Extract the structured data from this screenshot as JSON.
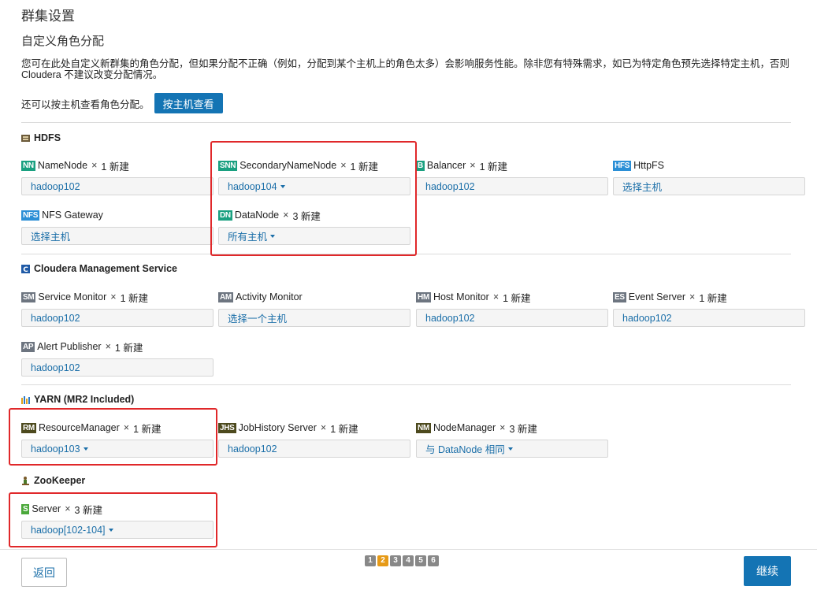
{
  "page_title": "群集设置",
  "sub_title": "自定义角色分配",
  "description": "您可在此处自定义新群集的角色分配，但如果分配不正确（例如，分配到某个主机上的角色太多）会影响服务性能。除非您有特殊需求，如已为特定角色预先选择特定主机，否则 Cloudera 不建议改变分配情况。",
  "host_view_text": "还可以按主机查看角色分配。",
  "host_view_button": "按主机查看",
  "colors": {
    "accent": "#1474b4",
    "highlight": "#e0282a"
  },
  "sections": {
    "hdfs": {
      "title": "HDFS",
      "icon": "hdfs-icon",
      "roles": [
        {
          "badge": "NN",
          "badge_color": "#1aa080",
          "name": "NameNode",
          "multiplier": "×",
          "count": "1 新建",
          "value": "hadoop102",
          "dropdown": false
        },
        {
          "badge": "SNN",
          "badge_color": "#1aa080",
          "name": "SecondaryNameNode",
          "multiplier": "×",
          "count": "1 新建",
          "value": "hadoop104",
          "dropdown": true
        },
        {
          "badge": "B",
          "badge_color": "#1aa080",
          "name": "Balancer",
          "multiplier": "×",
          "count": "1 新建",
          "value": "hadoop102",
          "dropdown": false
        },
        {
          "badge": "HFS",
          "badge_color": "#2b8fd6",
          "name": "HttpFS",
          "multiplier": "",
          "count": "",
          "value": "选择主机",
          "dropdown": false
        },
        {
          "badge": "NFS",
          "badge_color": "#2b8fd6",
          "name": "NFS Gateway",
          "multiplier": "",
          "count": "",
          "value": "选择主机",
          "dropdown": false
        },
        {
          "badge": "DN",
          "badge_color": "#1aa080",
          "name": "DataNode",
          "multiplier": "×",
          "count": "3 新建",
          "value": "所有主机",
          "dropdown": true
        }
      ]
    },
    "cms": {
      "title": "Cloudera Management Service",
      "icon": "cloudera-icon",
      "roles": [
        {
          "badge": "SM",
          "badge_color": "#6d7580",
          "name": "Service Monitor",
          "multiplier": "×",
          "count": "1 新建",
          "value": "hadoop102",
          "dropdown": false
        },
        {
          "badge": "AM",
          "badge_color": "#6d7580",
          "name": "Activity Monitor",
          "multiplier": "",
          "count": "",
          "value": "选择一个主机",
          "dropdown": false
        },
        {
          "badge": "HM",
          "badge_color": "#6d7580",
          "name": "Host Monitor",
          "multiplier": "×",
          "count": "1 新建",
          "value": "hadoop102",
          "dropdown": false
        },
        {
          "badge": "ES",
          "badge_color": "#6d7580",
          "name": "Event Server",
          "multiplier": "×",
          "count": "1 新建",
          "value": "hadoop102",
          "dropdown": false
        },
        {
          "badge": "AP",
          "badge_color": "#6d7580",
          "name": "Alert Publisher",
          "multiplier": "×",
          "count": "1 新建",
          "value": "hadoop102",
          "dropdown": false
        }
      ]
    },
    "yarn": {
      "title": "YARN (MR2 Included)",
      "icon": "yarn-icon",
      "roles": [
        {
          "badge": "RM",
          "badge_color": "#4d4a1e",
          "name": "ResourceManager",
          "multiplier": "×",
          "count": "1 新建",
          "value": "hadoop103",
          "dropdown": true
        },
        {
          "badge": "JHS",
          "badge_color": "#4d4a1e",
          "name": "JobHistory Server",
          "multiplier": "×",
          "count": "1 新建",
          "value": "hadoop102",
          "dropdown": false
        },
        {
          "badge": "NM",
          "badge_color": "#4d4a1e",
          "name": "NodeManager",
          "multiplier": "×",
          "count": "3 新建",
          "value": "与 DataNode 相同",
          "dropdown": true
        }
      ]
    },
    "zookeeper": {
      "title": "ZooKeeper",
      "icon": "zookeeper-icon",
      "roles": [
        {
          "badge": "S",
          "badge_color": "#4aa83a",
          "name": "Server",
          "multiplier": "×",
          "count": "3 新建",
          "value": "hadoop[102-104]",
          "dropdown": true
        }
      ]
    }
  },
  "footer": {
    "back_label": "返回",
    "continue_label": "继续",
    "steps": [
      "1",
      "2",
      "3",
      "4",
      "5",
      "6"
    ],
    "active_step": "2"
  }
}
